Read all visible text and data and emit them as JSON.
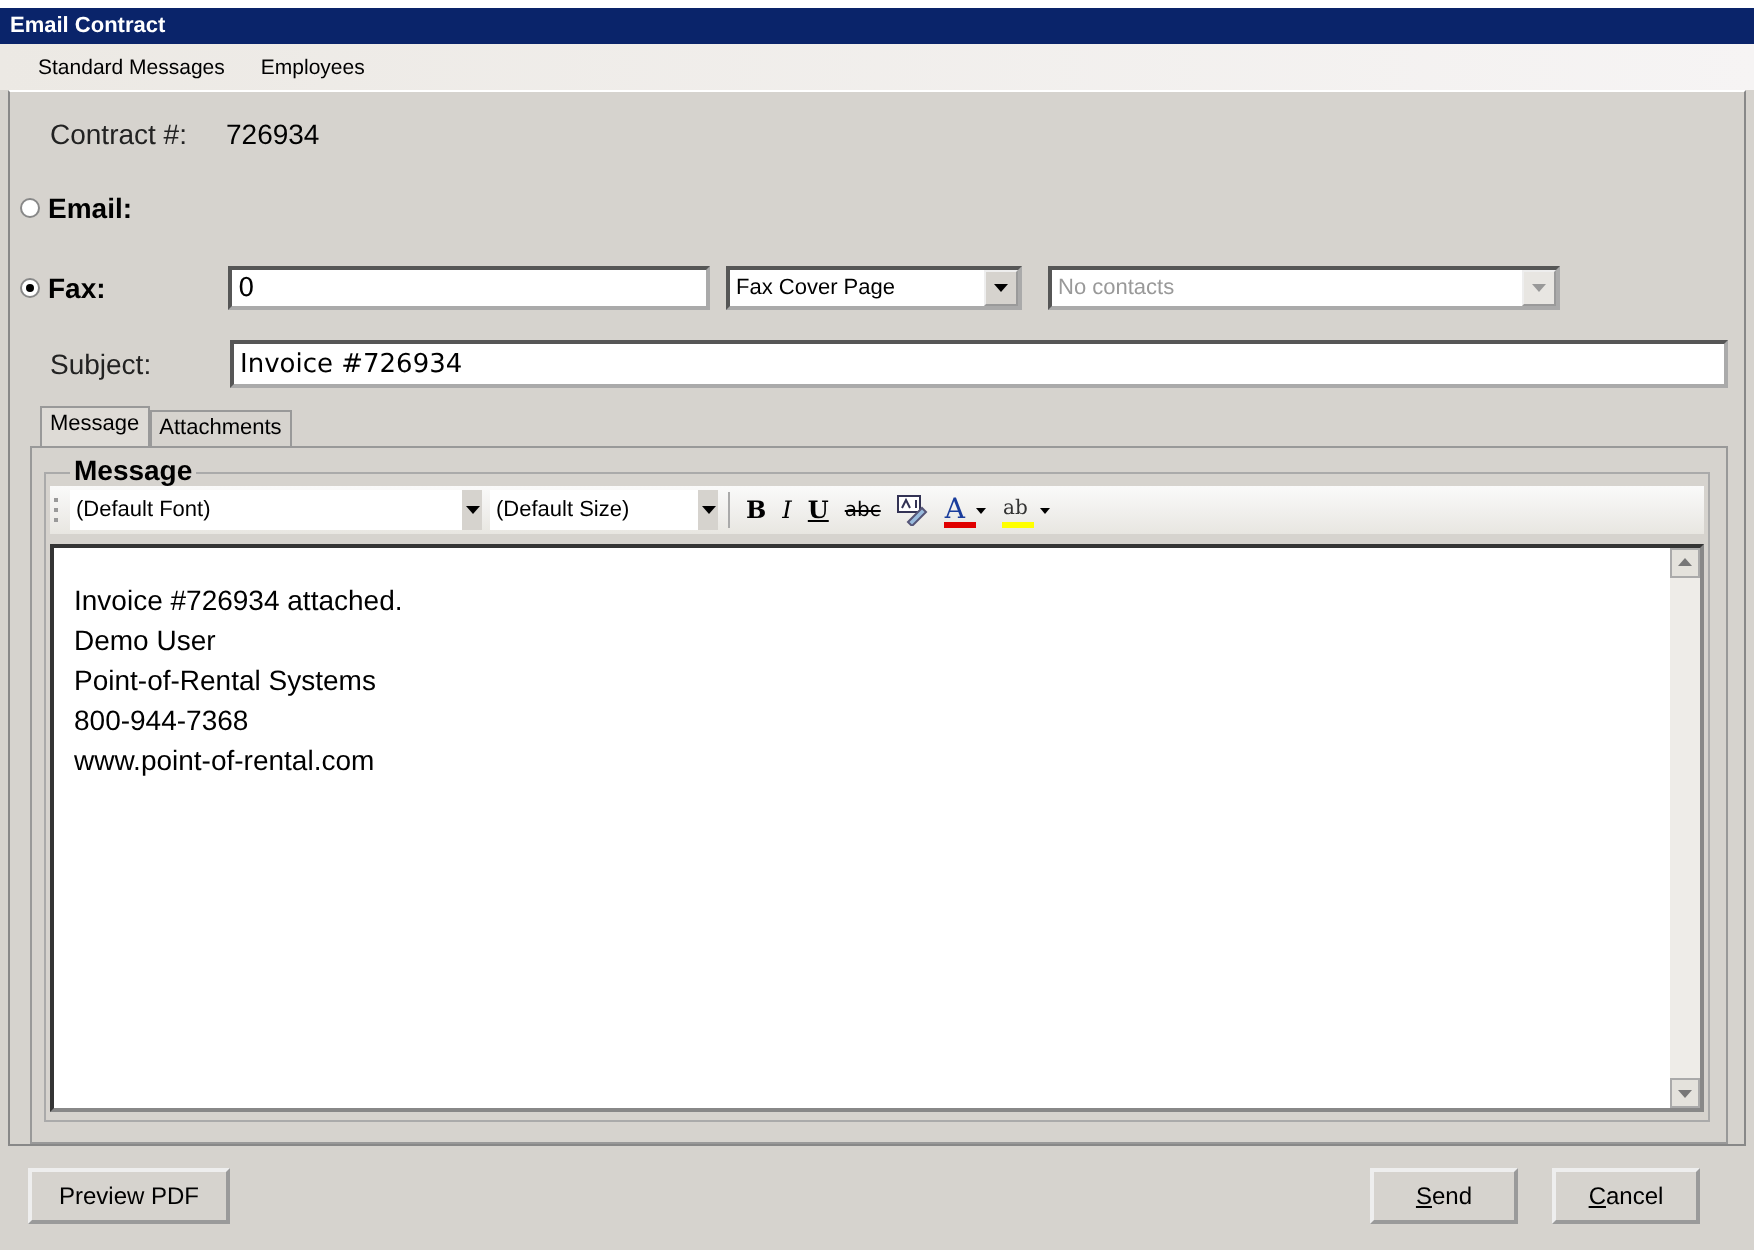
{
  "window": {
    "title": "Email Contract"
  },
  "menu": [
    "Standard Messages",
    "Employees"
  ],
  "contract": {
    "label": "Contract #:",
    "value": "726934"
  },
  "delivery": [
    {
      "label": "Email:",
      "selected": false
    },
    {
      "label": "Fax:",
      "selected": true,
      "number": "0",
      "cover": "Fax Cover Page",
      "contacts": {
        "placeholder": "No contacts",
        "disabled": true
      }
    }
  ],
  "subject": {
    "label": "Subject:",
    "value": "Invoice #726934"
  },
  "tabs": [
    {
      "label": "Message",
      "selected": true
    },
    {
      "label": "Attachments",
      "selected": false
    }
  ],
  "message": {
    "legend": "Message",
    "font": "(Default Font)",
    "size": "(Default Size)",
    "tools": [
      {
        "kind": "bold",
        "glyph": "B"
      },
      {
        "kind": "italic",
        "glyph": "I"
      },
      {
        "kind": "underline",
        "glyph": "U"
      },
      {
        "kind": "strike",
        "glyph": "abc"
      },
      {
        "kind": "spell"
      },
      {
        "kind": "fontcolor",
        "glyph": "A",
        "color": "#e00000"
      },
      {
        "kind": "highlight",
        "glyph": "ab",
        "color": "#ffff00"
      }
    ],
    "lines": [
      "Invoice #726934 attached.",
      "Demo User",
      "Point-of-Rental Systems",
      "800-944-7368",
      "www.point-of-rental.com"
    ]
  },
  "buttons": [
    {
      "label": "Preview PDF",
      "underline_first": false
    },
    {
      "label": "Send",
      "underline_first": true
    },
    {
      "label": "Cancel",
      "underline_first": true
    }
  ]
}
